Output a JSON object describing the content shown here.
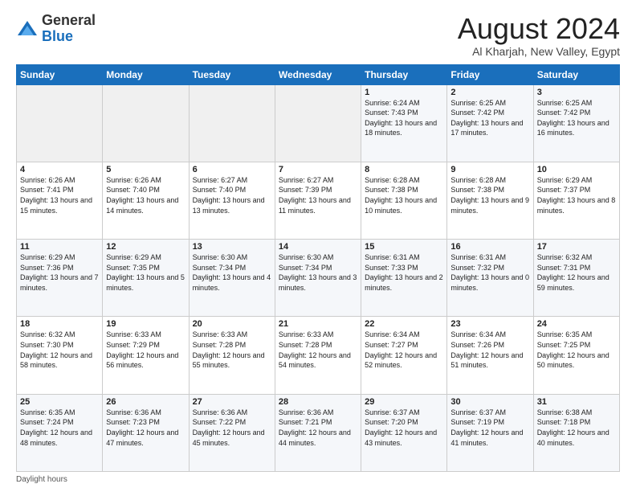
{
  "logo": {
    "general": "General",
    "blue": "Blue"
  },
  "title": "August 2024",
  "subtitle": "Al Kharjah, New Valley, Egypt",
  "days_of_week": [
    "Sunday",
    "Monday",
    "Tuesday",
    "Wednesday",
    "Thursday",
    "Friday",
    "Saturday"
  ],
  "footer": {
    "label": "Daylight hours"
  },
  "weeks": [
    [
      {
        "day": "",
        "sunrise": "",
        "sunset": "",
        "daylight": ""
      },
      {
        "day": "",
        "sunrise": "",
        "sunset": "",
        "daylight": ""
      },
      {
        "day": "",
        "sunrise": "",
        "sunset": "",
        "daylight": ""
      },
      {
        "day": "",
        "sunrise": "",
        "sunset": "",
        "daylight": ""
      },
      {
        "day": "1",
        "sunrise": "Sunrise: 6:24 AM",
        "sunset": "Sunset: 7:43 PM",
        "daylight": "Daylight: 13 hours and 18 minutes."
      },
      {
        "day": "2",
        "sunrise": "Sunrise: 6:25 AM",
        "sunset": "Sunset: 7:42 PM",
        "daylight": "Daylight: 13 hours and 17 minutes."
      },
      {
        "day": "3",
        "sunrise": "Sunrise: 6:25 AM",
        "sunset": "Sunset: 7:42 PM",
        "daylight": "Daylight: 13 hours and 16 minutes."
      }
    ],
    [
      {
        "day": "4",
        "sunrise": "Sunrise: 6:26 AM",
        "sunset": "Sunset: 7:41 PM",
        "daylight": "Daylight: 13 hours and 15 minutes."
      },
      {
        "day": "5",
        "sunrise": "Sunrise: 6:26 AM",
        "sunset": "Sunset: 7:40 PM",
        "daylight": "Daylight: 13 hours and 14 minutes."
      },
      {
        "day": "6",
        "sunrise": "Sunrise: 6:27 AM",
        "sunset": "Sunset: 7:40 PM",
        "daylight": "Daylight: 13 hours and 13 minutes."
      },
      {
        "day": "7",
        "sunrise": "Sunrise: 6:27 AM",
        "sunset": "Sunset: 7:39 PM",
        "daylight": "Daylight: 13 hours and 11 minutes."
      },
      {
        "day": "8",
        "sunrise": "Sunrise: 6:28 AM",
        "sunset": "Sunset: 7:38 PM",
        "daylight": "Daylight: 13 hours and 10 minutes."
      },
      {
        "day": "9",
        "sunrise": "Sunrise: 6:28 AM",
        "sunset": "Sunset: 7:38 PM",
        "daylight": "Daylight: 13 hours and 9 minutes."
      },
      {
        "day": "10",
        "sunrise": "Sunrise: 6:29 AM",
        "sunset": "Sunset: 7:37 PM",
        "daylight": "Daylight: 13 hours and 8 minutes."
      }
    ],
    [
      {
        "day": "11",
        "sunrise": "Sunrise: 6:29 AM",
        "sunset": "Sunset: 7:36 PM",
        "daylight": "Daylight: 13 hours and 7 minutes."
      },
      {
        "day": "12",
        "sunrise": "Sunrise: 6:29 AM",
        "sunset": "Sunset: 7:35 PM",
        "daylight": "Daylight: 13 hours and 5 minutes."
      },
      {
        "day": "13",
        "sunrise": "Sunrise: 6:30 AM",
        "sunset": "Sunset: 7:34 PM",
        "daylight": "Daylight: 13 hours and 4 minutes."
      },
      {
        "day": "14",
        "sunrise": "Sunrise: 6:30 AM",
        "sunset": "Sunset: 7:34 PM",
        "daylight": "Daylight: 13 hours and 3 minutes."
      },
      {
        "day": "15",
        "sunrise": "Sunrise: 6:31 AM",
        "sunset": "Sunset: 7:33 PM",
        "daylight": "Daylight: 13 hours and 2 minutes."
      },
      {
        "day": "16",
        "sunrise": "Sunrise: 6:31 AM",
        "sunset": "Sunset: 7:32 PM",
        "daylight": "Daylight: 13 hours and 0 minutes."
      },
      {
        "day": "17",
        "sunrise": "Sunrise: 6:32 AM",
        "sunset": "Sunset: 7:31 PM",
        "daylight": "Daylight: 12 hours and 59 minutes."
      }
    ],
    [
      {
        "day": "18",
        "sunrise": "Sunrise: 6:32 AM",
        "sunset": "Sunset: 7:30 PM",
        "daylight": "Daylight: 12 hours and 58 minutes."
      },
      {
        "day": "19",
        "sunrise": "Sunrise: 6:33 AM",
        "sunset": "Sunset: 7:29 PM",
        "daylight": "Daylight: 12 hours and 56 minutes."
      },
      {
        "day": "20",
        "sunrise": "Sunrise: 6:33 AM",
        "sunset": "Sunset: 7:28 PM",
        "daylight": "Daylight: 12 hours and 55 minutes."
      },
      {
        "day": "21",
        "sunrise": "Sunrise: 6:33 AM",
        "sunset": "Sunset: 7:28 PM",
        "daylight": "Daylight: 12 hours and 54 minutes."
      },
      {
        "day": "22",
        "sunrise": "Sunrise: 6:34 AM",
        "sunset": "Sunset: 7:27 PM",
        "daylight": "Daylight: 12 hours and 52 minutes."
      },
      {
        "day": "23",
        "sunrise": "Sunrise: 6:34 AM",
        "sunset": "Sunset: 7:26 PM",
        "daylight": "Daylight: 12 hours and 51 minutes."
      },
      {
        "day": "24",
        "sunrise": "Sunrise: 6:35 AM",
        "sunset": "Sunset: 7:25 PM",
        "daylight": "Daylight: 12 hours and 50 minutes."
      }
    ],
    [
      {
        "day": "25",
        "sunrise": "Sunrise: 6:35 AM",
        "sunset": "Sunset: 7:24 PM",
        "daylight": "Daylight: 12 hours and 48 minutes."
      },
      {
        "day": "26",
        "sunrise": "Sunrise: 6:36 AM",
        "sunset": "Sunset: 7:23 PM",
        "daylight": "Daylight: 12 hours and 47 minutes."
      },
      {
        "day": "27",
        "sunrise": "Sunrise: 6:36 AM",
        "sunset": "Sunset: 7:22 PM",
        "daylight": "Daylight: 12 hours and 45 minutes."
      },
      {
        "day": "28",
        "sunrise": "Sunrise: 6:36 AM",
        "sunset": "Sunset: 7:21 PM",
        "daylight": "Daylight: 12 hours and 44 minutes."
      },
      {
        "day": "29",
        "sunrise": "Sunrise: 6:37 AM",
        "sunset": "Sunset: 7:20 PM",
        "daylight": "Daylight: 12 hours and 43 minutes."
      },
      {
        "day": "30",
        "sunrise": "Sunrise: 6:37 AM",
        "sunset": "Sunset: 7:19 PM",
        "daylight": "Daylight: 12 hours and 41 minutes."
      },
      {
        "day": "31",
        "sunrise": "Sunrise: 6:38 AM",
        "sunset": "Sunset: 7:18 PM",
        "daylight": "Daylight: 12 hours and 40 minutes."
      }
    ]
  ]
}
